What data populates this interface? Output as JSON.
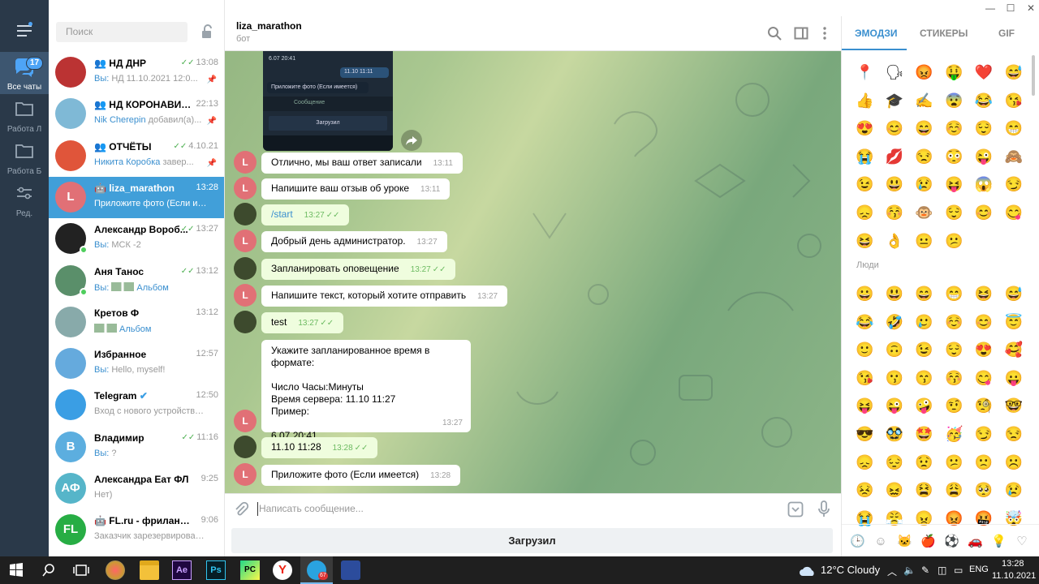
{
  "rail": {
    "items": [
      {
        "label": "Все чаты",
        "icon": "chat-bubbles-icon"
      },
      {
        "label": "Работа Л",
        "icon": "folder-icon"
      },
      {
        "label": "Работа Б",
        "icon": "folder-icon"
      },
      {
        "label": "Ред.",
        "icon": "sliders-icon"
      }
    ],
    "badge": "17"
  },
  "search": {
    "placeholder": "Поиск"
  },
  "chats": [
    {
      "name": "НД ДНР",
      "time": "13:08",
      "prefix": "Вы: ",
      "preview": "НД  11.10.2021  12:0...",
      "color": "#b33",
      "initials": ""
    },
    {
      "name": "НД КОРОНАВИРУС",
      "time": "22:13",
      "prefix": "Nik Cherepin ",
      "preview": "добавил(а)...",
      "color": "#7fb9d6",
      "initials": ""
    },
    {
      "name": "ОТЧЁТЫ",
      "time": "4.10.21",
      "prefix": "Никита Коробка ",
      "preview": "завер...",
      "color": "#e0553a",
      "initials": ""
    },
    {
      "name": "liza_marathon",
      "time": "13:28",
      "prefix": "",
      "preview": "Приложите фото (Если име...",
      "color": "#e17076",
      "initials": "L"
    },
    {
      "name": "Александр Вороб...",
      "time": "13:27",
      "prefix": "Вы: ",
      "preview": "МСК -2",
      "color": "#222",
      "initials": ""
    },
    {
      "name": "Аня Танос",
      "time": "13:12",
      "prefix": "Вы: ",
      "preview": "Альбом",
      "color": "#5a8f6a",
      "initials": ""
    },
    {
      "name": "Кретов Ф",
      "time": "13:12",
      "prefix": "",
      "preview": "Альбом",
      "color": "#8aa",
      "initials": ""
    },
    {
      "name": "Избранное",
      "time": "12:57",
      "prefix": "Вы: ",
      "preview": "Hello, myself!",
      "color": "#65aadd",
      "initials": ""
    },
    {
      "name": "Telegram",
      "time": "12:50",
      "prefix": "",
      "preview": "Вход с нового устройства. ...",
      "color": "#3a9ee4",
      "initials": ""
    },
    {
      "name": "Владимир",
      "time": "11:16",
      "prefix": "Вы: ",
      "preview": "?",
      "color": "#5caedf",
      "initials": "В"
    },
    {
      "name": "Александра Еат ФЛ",
      "time": "9:25",
      "prefix": "",
      "preview": "Нет)",
      "color": "#56b5c9",
      "initials": "АФ"
    },
    {
      "name": "FL.ru - фриланс са...",
      "time": "9:06",
      "prefix": "",
      "preview": "Заказчик зарезервировал с...",
      "color": "#27ad44",
      "initials": "FL"
    }
  ],
  "header": {
    "title": "liza_marathon",
    "subtitle": "бот"
  },
  "shot": {
    "msg_time": "6.07 20:41",
    "bubble": "11.10 11:11",
    "text": "Приложите фото (Если имеется)",
    "input_ph": "Сообщение",
    "button": "Загрузил"
  },
  "messages": [
    {
      "text": "Отлично, мы ваш ответ записали",
      "time": "13:11",
      "out": false
    },
    {
      "text": "Напишите ваш отзыв об уроке",
      "time": "13:11",
      "out": false
    },
    {
      "text": "/start",
      "time": "13:27",
      "out": true
    },
    {
      "text": "Добрый день администратор.",
      "time": "13:27",
      "out": false
    },
    {
      "text": "Запланировать оповещение",
      "time": "13:27",
      "out": true
    },
    {
      "text": "Напишите текст, который хотите отправить",
      "time": "13:27",
      "out": false
    },
    {
      "text": "test",
      "time": "13:27",
      "out": true
    },
    {
      "text": "Укажите запланированное время в формате:\n\nЧисло Часы:Минуты\nВремя сервера: 11.10 11:27\nПример:\n\n6.07 20:41",
      "time": "13:27",
      "out": false
    },
    {
      "text": "11.10 11:28",
      "time": "13:28",
      "out": true
    },
    {
      "text": "Приложите фото (Если имеется)",
      "time": "13:28",
      "out": false
    }
  ],
  "avatar_letter": "L",
  "input": {
    "placeholder": "Написать сообщение..."
  },
  "keyboard": {
    "button": "Загрузил"
  },
  "emoji_panel": {
    "tabs": [
      "ЭМОДЗИ",
      "СТИКЕРЫ",
      "GIF"
    ],
    "section": "Люди",
    "recent": [
      "📍",
      "🗣",
      "😡",
      "🤑",
      "❤️",
      "😅",
      "👍",
      "🎓",
      "✍️",
      "😨",
      "😂",
      "😘",
      "😍",
      "😊",
      "😄",
      "☺️",
      "😌",
      "😁",
      "😭",
      "💋",
      "😒",
      "😳",
      "😜",
      "🙈",
      "😉",
      "😃",
      "😢",
      "😝",
      "😱",
      "😏",
      "😞",
      "😚",
      "🐵",
      "😌",
      "😊",
      "😋",
      "😆",
      "👌",
      "😐",
      "😕"
    ],
    "people": [
      "😀",
      "😃",
      "😄",
      "😁",
      "😆",
      "😅",
      "😂",
      "🤣",
      "🥲",
      "☺️",
      "😊",
      "😇",
      "🙂",
      "🙃",
      "😉",
      "😌",
      "😍",
      "🥰",
      "😘",
      "😗",
      "😙",
      "😚",
      "😋",
      "😛",
      "😝",
      "😜",
      "🤪",
      "🤨",
      "🧐",
      "🤓",
      "😎",
      "🥸",
      "🤩",
      "🥳",
      "😏",
      "😒",
      "😞",
      "😔",
      "😟",
      "😕",
      "🙁",
      "☹️",
      "😣",
      "😖",
      "😫",
      "😩",
      "🥺",
      "😢",
      "😭",
      "😤",
      "😠",
      "😡",
      "🤬",
      "🤯"
    ],
    "bottom_icons": [
      "clock-icon",
      "smile-icon",
      "cat-icon",
      "apple-icon",
      "ball-icon",
      "car-icon",
      "bulb-icon",
      "heart-icon"
    ]
  },
  "taskbar": {
    "weather": "12°C  Cloudy",
    "lang": "ENG",
    "time": "13:28",
    "date": "11.10.2021",
    "tg_badge": "67"
  }
}
